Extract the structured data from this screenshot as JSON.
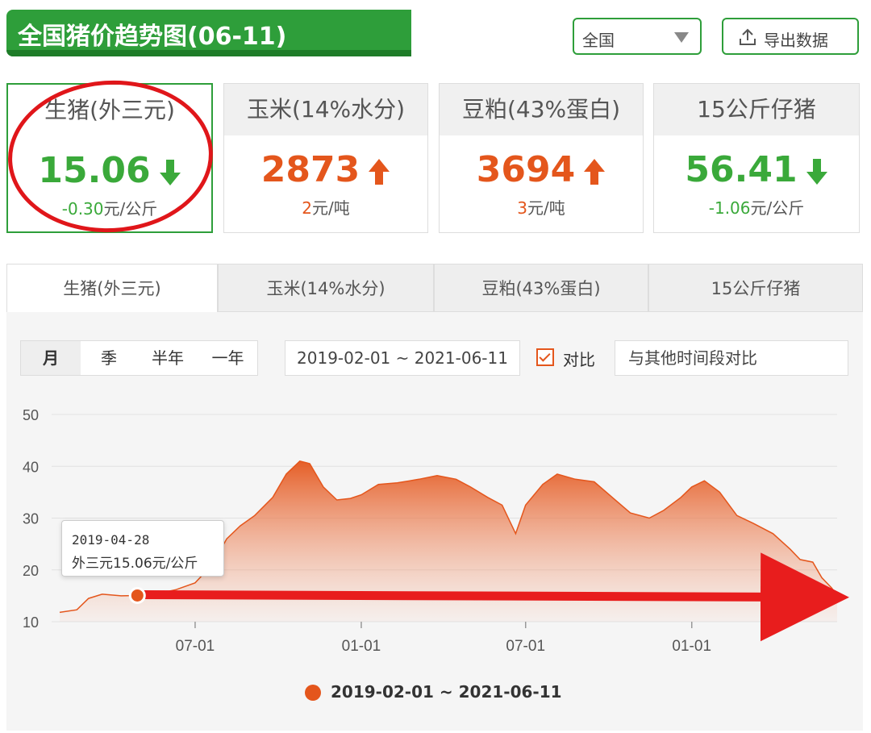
{
  "header": {
    "title": "全国猪价趋势图(06-11)",
    "region": "全国",
    "export_label": "导出数据"
  },
  "cards": [
    {
      "name": "生猪(外三元)",
      "price": "15.06",
      "trend": "down",
      "change_num": "-0.30",
      "change_unit": "元/公斤",
      "color": "#3aa93a"
    },
    {
      "name": "玉米(14%水分)",
      "price": "2873",
      "trend": "up",
      "change_num": "2",
      "change_unit": "元/吨",
      "color": "#e4561c"
    },
    {
      "name": "豆粕(43%蛋白)",
      "price": "3694",
      "trend": "up",
      "change_num": "3",
      "change_unit": "元/吨",
      "color": "#e4561c"
    },
    {
      "name": "15公斤仔猪",
      "price": "56.41",
      "trend": "down",
      "change_num": "-1.06",
      "change_unit": "元/公斤",
      "color": "#3aa93a"
    }
  ],
  "tabs": [
    "生猪(外三元)",
    "玉米(14%水分)",
    "豆粕(43%蛋白)",
    "15公斤仔猪"
  ],
  "controls": {
    "periods": [
      "月",
      "季",
      "半年",
      "一年"
    ],
    "date_range": "2019-02-01 ~ 2021-06-11",
    "compare_label": "对比",
    "compare_placeholder": "与其他时间段对比"
  },
  "tooltip": {
    "date": "2019-04-28",
    "value": "外三元15.06元/公斤"
  },
  "chart_data": {
    "type": "area",
    "x_ticks": [
      "07-01",
      "01-01",
      "07-01",
      "01-01"
    ],
    "y_ticks": [
      10,
      20,
      30,
      40,
      50
    ],
    "ylim": [
      10,
      50
    ],
    "grid": true,
    "legend": "bottom",
    "series": [
      {
        "name": "2019-02-01 ~ 2021-06-11",
        "color": "#e4561c",
        "points": [
          [
            "2019-02-01",
            11.8
          ],
          [
            "2019-02-20",
            12.3
          ],
          [
            "2019-03-05",
            14.5
          ],
          [
            "2019-03-20",
            15.3
          ],
          [
            "2019-04-10",
            15.0
          ],
          [
            "2019-04-28",
            15.06
          ],
          [
            "2019-05-20",
            15.4
          ],
          [
            "2019-06-10",
            16.2
          ],
          [
            "2019-07-01",
            17.5
          ],
          [
            "2019-07-20",
            21.0
          ],
          [
            "2019-08-05",
            26.0
          ],
          [
            "2019-08-20",
            28.5
          ],
          [
            "2019-09-05",
            30.5
          ],
          [
            "2019-09-25",
            34.0
          ],
          [
            "2019-10-10",
            38.5
          ],
          [
            "2019-10-25",
            41.0
          ],
          [
            "2019-11-05",
            40.5
          ],
          [
            "2019-11-20",
            36.0
          ],
          [
            "2019-12-05",
            33.5
          ],
          [
            "2019-12-20",
            33.8
          ],
          [
            "2020-01-01",
            34.5
          ],
          [
            "2020-01-20",
            36.5
          ],
          [
            "2020-02-10",
            36.8
          ],
          [
            "2020-03-05",
            37.5
          ],
          [
            "2020-03-25",
            38.2
          ],
          [
            "2020-04-15",
            37.5
          ],
          [
            "2020-05-01",
            36.0
          ],
          [
            "2020-05-20",
            34.0
          ],
          [
            "2020-06-05",
            32.5
          ],
          [
            "2020-06-20",
            27.0
          ],
          [
            "2020-07-01",
            32.5
          ],
          [
            "2020-07-20",
            36.5
          ],
          [
            "2020-08-05",
            38.5
          ],
          [
            "2020-08-25",
            37.5
          ],
          [
            "2020-09-15",
            37.0
          ],
          [
            "2020-10-05",
            34.0
          ],
          [
            "2020-10-25",
            31.0
          ],
          [
            "2020-11-15",
            30.0
          ],
          [
            "2020-12-01",
            31.5
          ],
          [
            "2020-12-20",
            34.0
          ],
          [
            "2021-01-01",
            36.0
          ],
          [
            "2021-01-15",
            37.2
          ],
          [
            "2021-02-01",
            35.0
          ],
          [
            "2021-02-20",
            30.5
          ],
          [
            "2021-03-10",
            29.0
          ],
          [
            "2021-04-01",
            27.0
          ],
          [
            "2021-04-20",
            24.0
          ],
          [
            "2021-05-01",
            22.0
          ],
          [
            "2021-05-15",
            21.5
          ],
          [
            "2021-05-25",
            18.5
          ],
          [
            "2021-06-05",
            16.5
          ],
          [
            "2021-06-11",
            15.06
          ]
        ]
      }
    ]
  }
}
